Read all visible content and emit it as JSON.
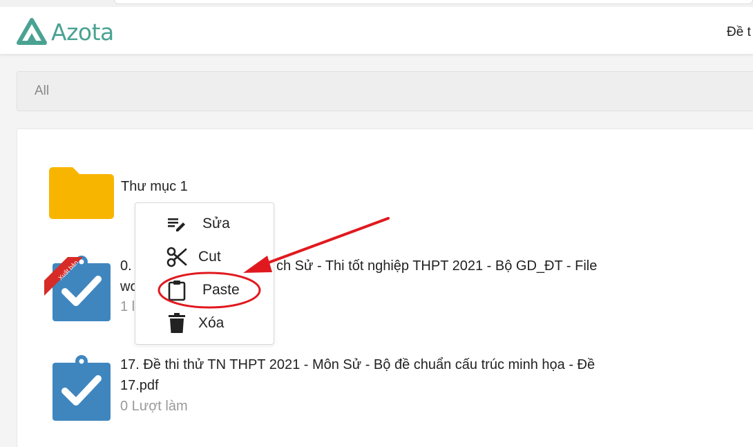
{
  "header": {
    "logo_text": "Azota",
    "nav_partial": "Đề t"
  },
  "breadcrumb": {
    "label": "All"
  },
  "folders": [
    {
      "name": "Thư mục 1",
      "icon": "folder-icon",
      "color": "#f7b500"
    }
  ],
  "documents": [
    {
      "title_part1": "0.",
      "title_part2": "ch Sử - Thi tốt nghiệp THPT 2021 - Bộ GD_ĐT - File",
      "title_part3": "wo",
      "meta": "1 l",
      "badge": "Xuất bản",
      "icon": "clipboard-check-icon"
    },
    {
      "title": "17. Đề thi thử TN THPT 2021 - Môn Sử - Bộ đề chuẩn cấu trúc minh họa - Đề 17.pdf",
      "meta": "0 Lượt làm",
      "icon": "clipboard-check-icon"
    }
  ],
  "context_menu": {
    "items": [
      {
        "label": "Sửa",
        "icon": "edit-icon"
      },
      {
        "label": "Cut",
        "icon": "scissors-icon"
      },
      {
        "label": "Paste",
        "icon": "clipboard-icon"
      },
      {
        "label": "Xóa",
        "icon": "trash-icon"
      }
    ]
  },
  "colors": {
    "brand": "#4aa292",
    "folder": "#f7b500",
    "doc_icon": "#3f86bf",
    "annotation": "#e0191f"
  }
}
